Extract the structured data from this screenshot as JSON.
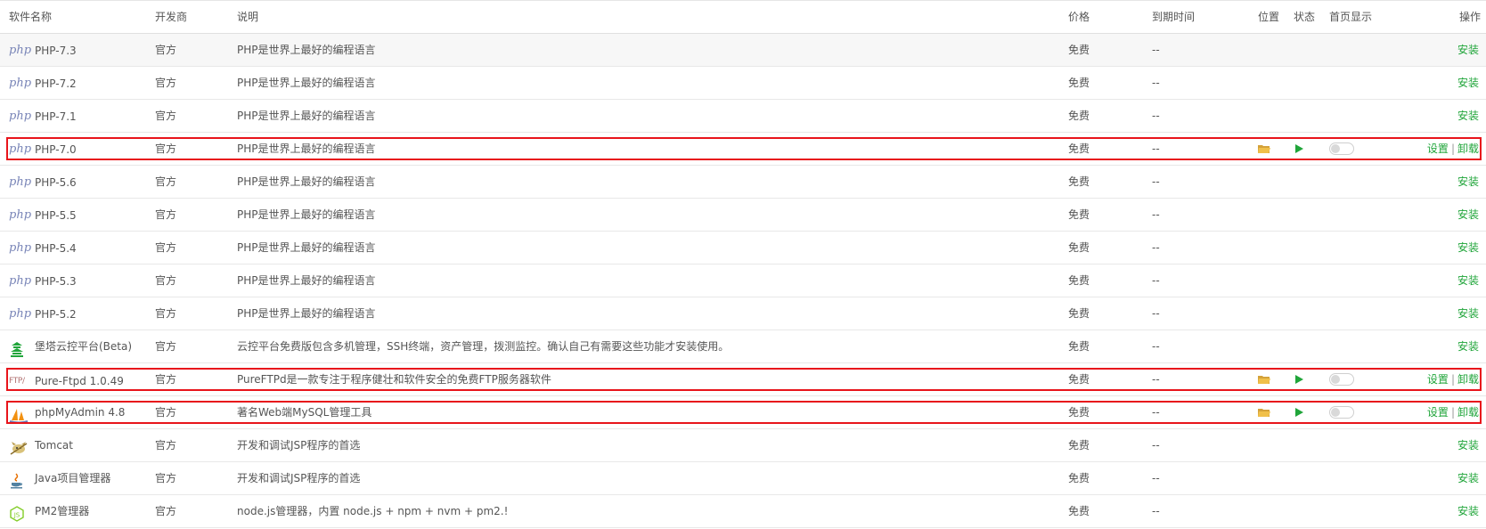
{
  "header": {
    "name": "软件名称",
    "developer": "开发商",
    "description": "说明",
    "price": "价格",
    "expiry": "到期时间",
    "location": "位置",
    "status": "状态",
    "homepage": "首页显示",
    "actions": "操作"
  },
  "labels": {
    "install": "安装",
    "settings": "设置",
    "uninstall": "卸载",
    "separator": "|"
  },
  "colors": {
    "accent_green": "#20a53a",
    "highlight_red": "#e8141b",
    "folder_yellow": "#f0c04a"
  },
  "rows": [
    {
      "icon": "php-logo-icon",
      "icon_text": "php",
      "name": "PHP-7.3",
      "developer": "官方",
      "description": "PHP是世界上最好的编程语言",
      "price": "免费",
      "expiry": "--",
      "installed": false
    },
    {
      "icon": "php-logo-icon",
      "icon_text": "php",
      "name": "PHP-7.2",
      "developer": "官方",
      "description": "PHP是世界上最好的编程语言",
      "price": "免费",
      "expiry": "--",
      "installed": false
    },
    {
      "icon": "php-logo-icon",
      "icon_text": "php",
      "name": "PHP-7.1",
      "developer": "官方",
      "description": "PHP是世界上最好的编程语言",
      "price": "免费",
      "expiry": "--",
      "installed": false
    },
    {
      "icon": "php-logo-icon",
      "icon_text": "php",
      "name": "PHP-7.0",
      "developer": "官方",
      "description": "PHP是世界上最好的编程语言",
      "price": "免费",
      "expiry": "--",
      "installed": true,
      "highlighted": true
    },
    {
      "icon": "php-logo-icon",
      "icon_text": "php",
      "name": "PHP-5.6",
      "developer": "官方",
      "description": "PHP是世界上最好的编程语言",
      "price": "免费",
      "expiry": "--",
      "installed": false
    },
    {
      "icon": "php-logo-icon",
      "icon_text": "php",
      "name": "PHP-5.5",
      "developer": "官方",
      "description": "PHP是世界上最好的编程语言",
      "price": "免费",
      "expiry": "--",
      "installed": false
    },
    {
      "icon": "php-logo-icon",
      "icon_text": "php",
      "name": "PHP-5.4",
      "developer": "官方",
      "description": "PHP是世界上最好的编程语言",
      "price": "免费",
      "expiry": "--",
      "installed": false
    },
    {
      "icon": "php-logo-icon",
      "icon_text": "php",
      "name": "PHP-5.3",
      "developer": "官方",
      "description": "PHP是世界上最好的编程语言",
      "price": "免费",
      "expiry": "--",
      "installed": false
    },
    {
      "icon": "php-logo-icon",
      "icon_text": "php",
      "name": "PHP-5.2",
      "developer": "官方",
      "description": "PHP是世界上最好的编程语言",
      "price": "免费",
      "expiry": "--",
      "installed": false
    },
    {
      "icon": "pagoda-icon",
      "icon_text": "",
      "name": "堡塔云控平台(Beta)",
      "developer": "官方",
      "description": "云控平台免费版包含多机管理，SSH终端，资产管理，拨测监控。确认自己有需要这些功能才安装使用。",
      "price": "免费",
      "expiry": "--",
      "installed": false
    },
    {
      "icon": "ftp-logo-icon",
      "icon_text": "FTP/",
      "name": "Pure-Ftpd 1.0.49",
      "developer": "官方",
      "description": "PureFTPd是一款专注于程序健壮和软件安全的免费FTP服务器软件",
      "price": "免费",
      "expiry": "--",
      "installed": true,
      "highlighted": true
    },
    {
      "icon": "phpmyadmin-sail-icon",
      "icon_text": "",
      "name": "phpMyAdmin 4.8",
      "developer": "官方",
      "description": "著名Web端MySQL管理工具",
      "price": "免费",
      "expiry": "--",
      "installed": true,
      "highlighted": true
    },
    {
      "icon": "tomcat-icon",
      "icon_text": "",
      "name": "Tomcat",
      "developer": "官方",
      "description": "开发和调试JSP程序的首选",
      "price": "免费",
      "expiry": "--",
      "installed": false
    },
    {
      "icon": "java-cup-icon",
      "icon_text": "",
      "name": "Java项目管理器",
      "developer": "官方",
      "description": "开发和调试JSP程序的首选",
      "price": "免费",
      "expiry": "--",
      "installed": false
    },
    {
      "icon": "nodejs-hex-icon",
      "icon_text": "",
      "name": "PM2管理器",
      "developer": "官方",
      "description": "node.js管理器，内置 node.js + npm + nvm + pm2.!",
      "price": "免费",
      "expiry": "--",
      "installed": false
    }
  ]
}
